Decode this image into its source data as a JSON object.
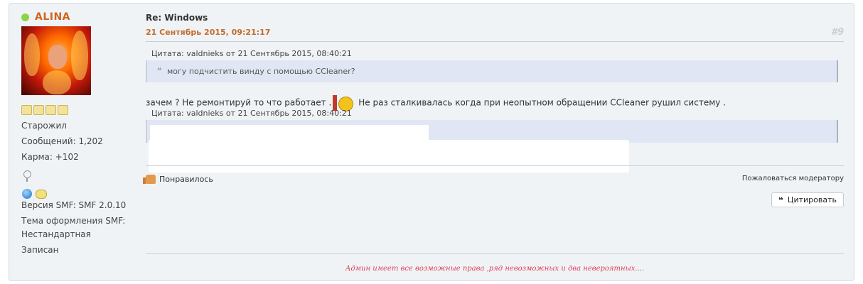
{
  "poster": {
    "name": "ALINA",
    "rank": "Старожил",
    "posts": "Сообщений: 1,202",
    "karma": "Карма: +102",
    "smf_version": "Версия SMF: SMF 2.0.10",
    "theme_line1": "Тема оформления SMF:",
    "theme_line2": "Нестандартная",
    "status": "Записан",
    "star_count": 4
  },
  "post": {
    "title": "Re: Windows",
    "date": "21 Сентябрь 2015, 09:21:17",
    "number": "#9",
    "quote1": {
      "header": "Цитата: valdnieks от 21 Сентябрь 2015, 08:40:21",
      "text": "могу подчистить винду с помощью CCleaner?"
    },
    "body_part1": "зачем ? Не ремонтируй то что работает .",
    "body_part2": "Не раз сталкивалась когда при неопытном обращении CCleaner рушил систему .",
    "quote2": {
      "header": "Цитата: valdnieks от 21 Сентябрь 2015, 08:40:21"
    },
    "like_label": "Понравилось",
    "report_label": "Пожаловаться модератору",
    "quote_button_label": "Цитировать",
    "signature": "Админ имеет все возможные права ,ряд невозможных и два невероятных...."
  },
  "colors": {
    "poster_name": "#d0641e",
    "date": "#c26a2b",
    "quote_bg": "#e0e6f4",
    "signature": "#e0415a",
    "online": "#8bd34a"
  }
}
